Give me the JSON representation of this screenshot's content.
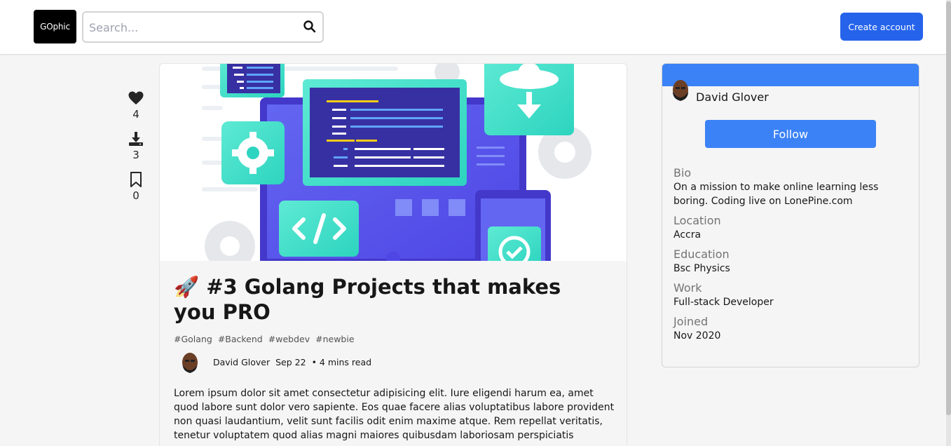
{
  "header": {
    "logo_text": "GOphic",
    "search_placeholder": "Search...",
    "create_account_label": "Create account",
    "accent_color": "#2563eb"
  },
  "reactions": [
    {
      "icon": "heart-icon",
      "count": "4"
    },
    {
      "icon": "download-icon",
      "count": "3"
    },
    {
      "icon": "bookmark-icon",
      "count": "0"
    }
  ],
  "article": {
    "title_emoji": "🚀",
    "title": "#3 Golang Projects that makes you PRO",
    "tags": [
      "#Golang",
      "#Backend",
      "#webdev",
      "#newbie"
    ],
    "author": "David Glover",
    "date": "Sep 22",
    "read_time": "• 4 mins read",
    "body": "Lorem ipsum dolor sit amet consectetur adipisicing elit. Iure eligendi harum ea, amet quod labore sunt dolor vero sapiente. Eos quae facere alias voluptatibus labore provident non quasi laudantium, velit sunt facilis odit enim maxime atque. Rem repellat veritatis, tenetur voluptatem quod alias magni maiores quibusdam laboriosam perspiciatis"
  },
  "profile": {
    "name": "David Glover",
    "follow_label": "Follow",
    "banner_color": "#3b82f6",
    "details": [
      {
        "label": "Bio",
        "value": "On a mission to make online learning less boring. Coding live on LonePine.com"
      },
      {
        "label": "Location",
        "value": "Accra"
      },
      {
        "label": "Education",
        "value": "Bsc Physics"
      },
      {
        "label": "Work",
        "value": "Full-stack Developer"
      },
      {
        "label": "Joined",
        "value": "Nov 2020"
      }
    ]
  }
}
